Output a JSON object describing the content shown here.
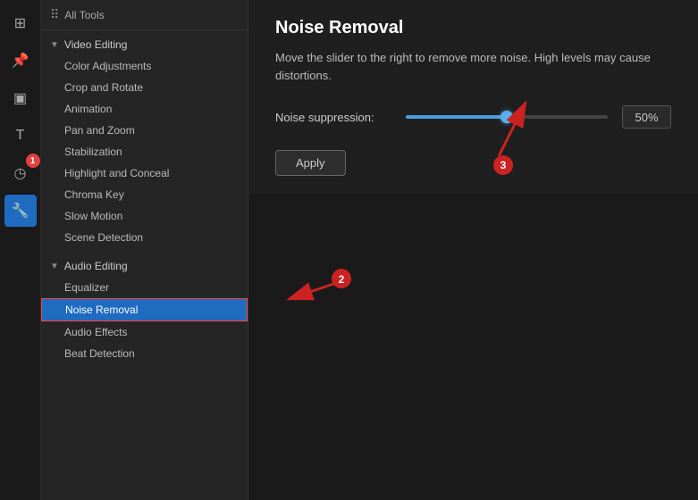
{
  "iconBar": {
    "icons": [
      {
        "name": "grid-icon",
        "symbol": "⊞",
        "active": false,
        "badge": null
      },
      {
        "name": "pin-icon",
        "symbol": "📌",
        "active": false,
        "badge": null
      },
      {
        "name": "crop-icon",
        "symbol": "▣",
        "active": false,
        "badge": null
      },
      {
        "name": "text-icon",
        "symbol": "T",
        "active": false,
        "badge": null
      },
      {
        "name": "clock-icon",
        "symbol": "◷",
        "active": false,
        "badge": "1"
      },
      {
        "name": "tools-icon",
        "symbol": "🔧",
        "active": true,
        "badge": null
      }
    ]
  },
  "sidebar": {
    "allToolsLabel": "All Tools",
    "sections": [
      {
        "id": "video-editing",
        "label": "Video Editing",
        "expanded": true,
        "items": [
          {
            "id": "color-adjustments",
            "label": "Color Adjustments",
            "active": false
          },
          {
            "id": "crop-and-rotate",
            "label": "Crop and Rotate",
            "active": false
          },
          {
            "id": "animation",
            "label": "Animation",
            "active": false
          },
          {
            "id": "pan-and-zoom",
            "label": "Pan and Zoom",
            "active": false
          },
          {
            "id": "stabilization",
            "label": "Stabilization",
            "active": false
          },
          {
            "id": "highlight-and-conceal",
            "label": "Highlight and Conceal",
            "active": false
          },
          {
            "id": "chroma-key",
            "label": "Chroma Key",
            "active": false
          },
          {
            "id": "slow-motion",
            "label": "Slow Motion",
            "active": false
          },
          {
            "id": "scene-detection",
            "label": "Scene Detection",
            "active": false
          }
        ]
      },
      {
        "id": "audio-editing",
        "label": "Audio Editing",
        "expanded": true,
        "items": [
          {
            "id": "equalizer",
            "label": "Equalizer",
            "active": false
          },
          {
            "id": "noise-removal",
            "label": "Noise Removal",
            "active": true
          },
          {
            "id": "audio-effects",
            "label": "Audio Effects",
            "active": false
          },
          {
            "id": "beat-detection",
            "label": "Beat Detection",
            "active": false
          }
        ]
      }
    ]
  },
  "mainPanel": {
    "title": "Noise Removal",
    "description": "Move the slider to the right to remove more noise. High levels may cause distortions.",
    "noiseSuppressionLabel": "Noise suppression:",
    "sliderValue": 50,
    "sliderValueDisplay": "50%",
    "sliderPercent": 50,
    "applyLabel": "Apply"
  },
  "annotations": {
    "badge1": "1",
    "badge2": "2",
    "badge3": "3"
  }
}
